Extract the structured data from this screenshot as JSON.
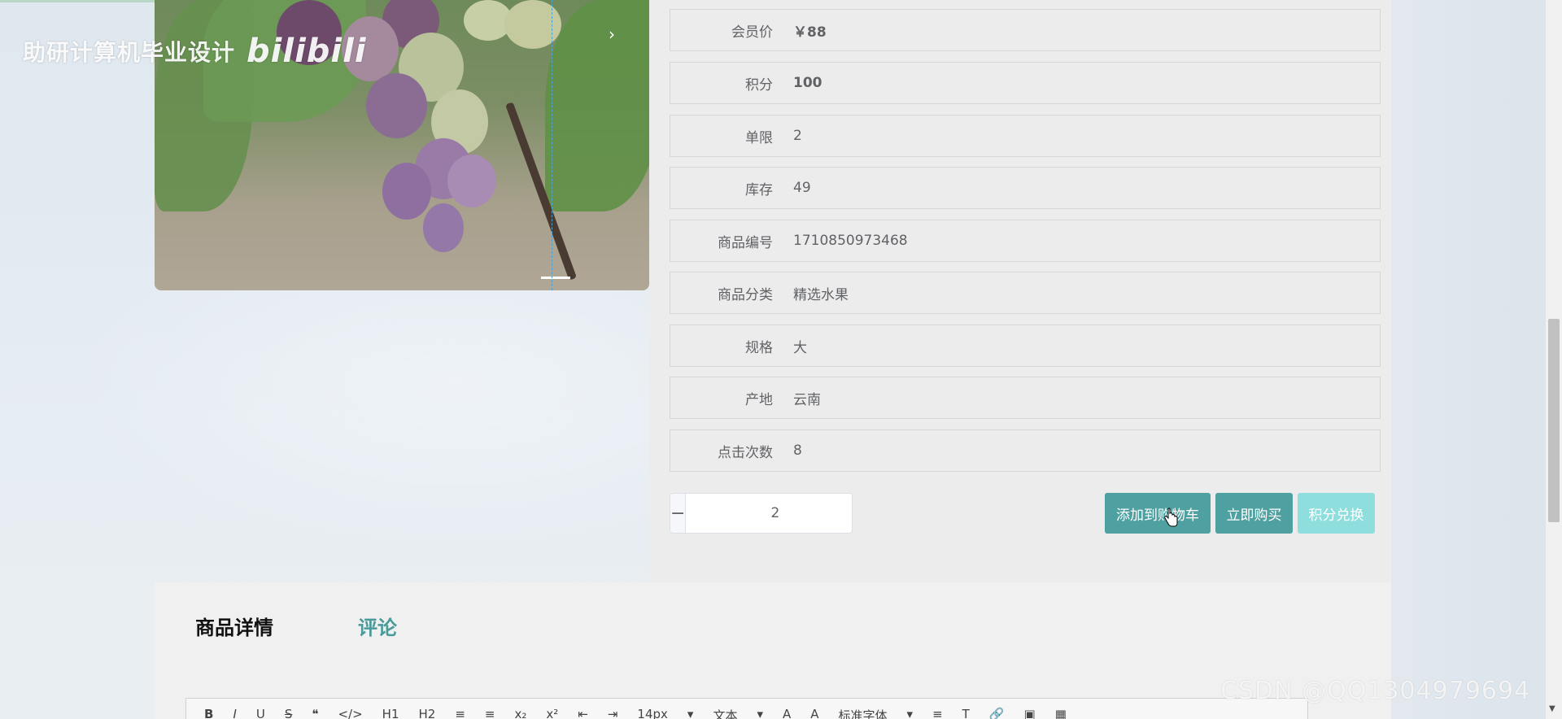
{
  "watermark": {
    "channel": "助研计算机毕业设计",
    "logo": "bilibili",
    "csdn": "CSDN @QQ1304979694"
  },
  "carousel": {
    "next_icon": "›",
    "current_index": 1
  },
  "product_info": [
    {
      "label": "会员价",
      "value": "￥88",
      "bold": true
    },
    {
      "label": "积分",
      "value": "100",
      "bold": true
    },
    {
      "label": "单限",
      "value": "2"
    },
    {
      "label": "库存",
      "value": "49"
    },
    {
      "label": "商品编号",
      "value": "1710850973468"
    },
    {
      "label": "商品分类",
      "value": "精选水果"
    },
    {
      "label": "规格",
      "value": "大"
    },
    {
      "label": "产地",
      "value": "云南"
    },
    {
      "label": "点击次数",
      "value": "8"
    }
  ],
  "quantity": {
    "minus": "−",
    "plus": "+",
    "value": "2"
  },
  "actions": {
    "add_to_cart": "添加到购物车",
    "buy_now": "立即购买",
    "points_exchange": "积分兑换"
  },
  "tabs": {
    "detail": "商品详情",
    "comment": "评论"
  },
  "editor_toolbar": [
    "B",
    "I",
    "U",
    "S",
    "❝",
    "</>",
    "H1",
    "H2",
    "≡",
    "≡",
    "x₂",
    "x²",
    "⇤",
    "⇥",
    "14px",
    "▾",
    "文本",
    "▾",
    "A",
    "A",
    "标准字体",
    "▾",
    "≡",
    "T",
    "🔗",
    "▣",
    "▦"
  ],
  "colors": {
    "primary": "#4fa0a0",
    "primary_light": "#8fdede",
    "tab_active": "#4a9a9a"
  }
}
